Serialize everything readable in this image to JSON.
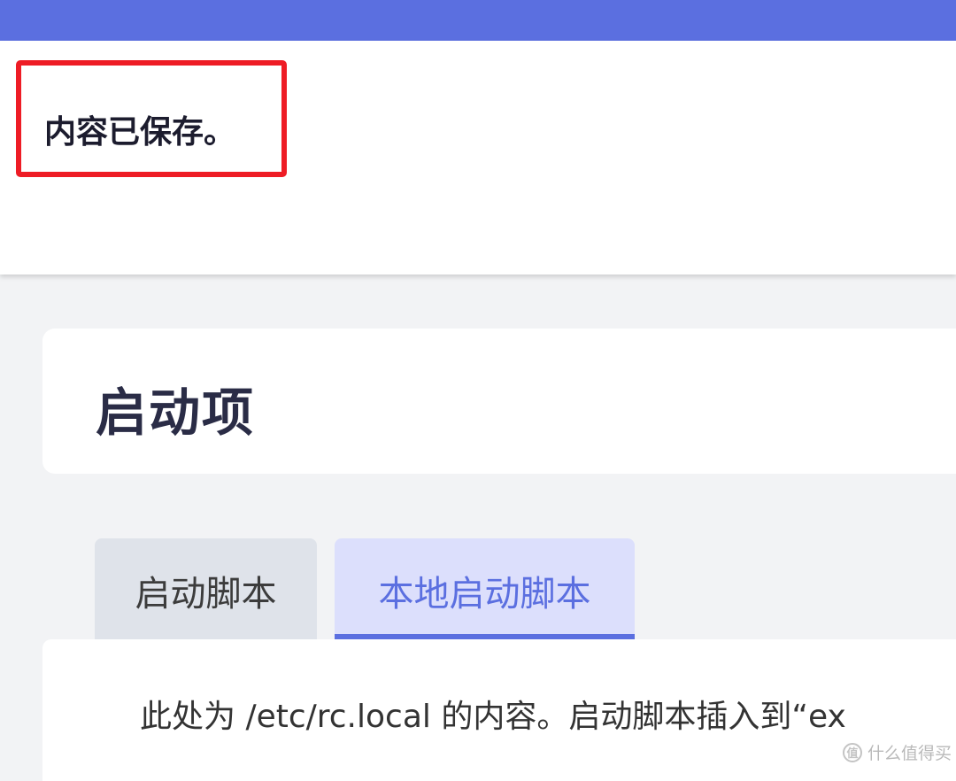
{
  "colors": {
    "accent": "#5b6fe0",
    "highlight_border": "#ee1c25",
    "tab_active_bg": "#dcdffc",
    "tab_inactive_bg": "#dfe3ea"
  },
  "alert": {
    "message": "内容已保存。"
  },
  "page": {
    "title": "启动项"
  },
  "tabs": [
    {
      "label": "启动脚本",
      "active": false
    },
    {
      "label": "本地启动脚本",
      "active": true
    }
  ],
  "content": {
    "description": "此处为 /etc/rc.local 的内容。启动脚本插入到“ex"
  },
  "watermark": {
    "text": "什么值得买",
    "logo_glyph": "值"
  }
}
